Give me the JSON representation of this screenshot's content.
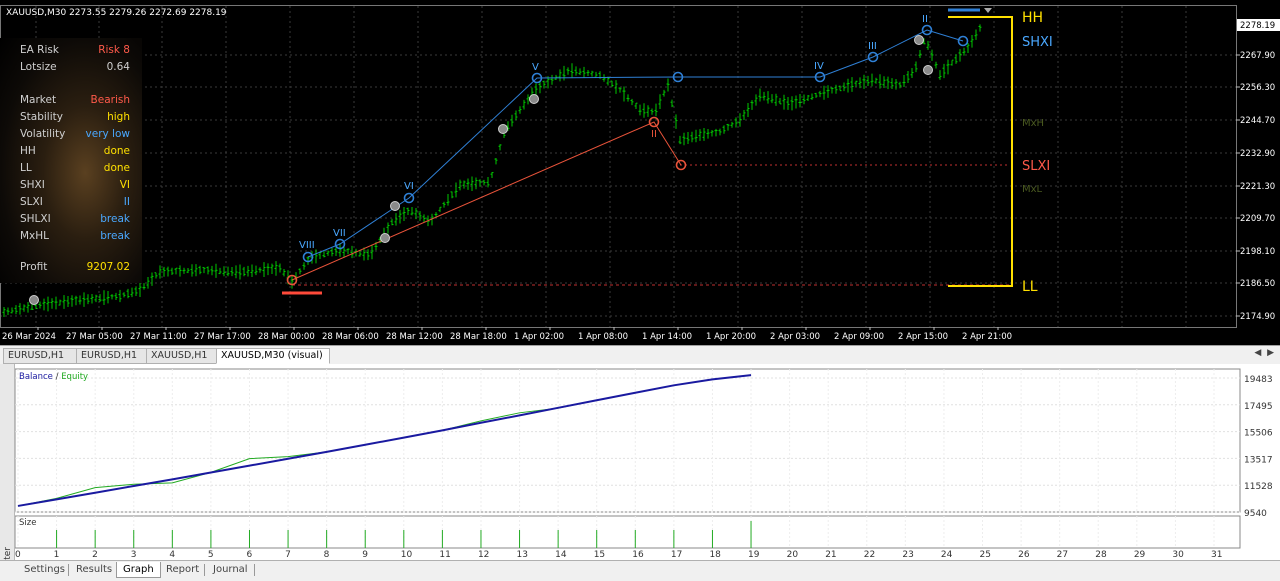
{
  "chart": {
    "symbol_info": "XAUUSD,M30  2273.55 2279.26 2272.69 2278.19",
    "current_price": "2278.19",
    "y_axis": [
      "2267.90",
      "2256.30",
      "2244.70",
      "2232.90",
      "2221.30",
      "2209.70",
      "2198.10",
      "2186.50",
      "2174.90"
    ],
    "x_axis": [
      "26 Mar 2024",
      "27 Mar 05:00",
      "27 Mar 11:00",
      "27 Mar 17:00",
      "28 Mar 00:00",
      "28 Mar 06:00",
      "28 Mar 12:00",
      "28 Mar 18:00",
      "1 Apr 02:00",
      "1 Apr 08:00",
      "1 Apr 14:00",
      "1 Apr 20:00",
      "2 Apr 03:00",
      "2 Apr 09:00",
      "2 Apr 15:00",
      "2 Apr 21:00"
    ],
    "range_labels": {
      "hh": "HH",
      "shxi": "SHXI",
      "mxh": "MxH",
      "slxi": "SLXI",
      "mxl": "MxL",
      "ll": "LL"
    },
    "swing_labels_high": [
      "VIII",
      "VII",
      "VI",
      "V",
      "IV",
      "III",
      "II"
    ],
    "swing_labels_low": [
      "II"
    ],
    "colors": {
      "up": "#00c800",
      "down": "#00c800",
      "high_line": "#2f80d6",
      "low_line": "#e8533a",
      "level": "#ffe000",
      "bg": "#000000"
    }
  },
  "ea_panel": {
    "rows": [
      {
        "key": "EA Risk",
        "value": "Risk 8",
        "color": "#ff5a4a"
      },
      {
        "key": "Lotsize",
        "value": "0.64",
        "color": "#d0d0d0"
      },
      {
        "key": "Market",
        "value": "Bearish",
        "color": "#ff5a4a"
      },
      {
        "key": "Stability",
        "value": "high",
        "color": "#ffe000"
      },
      {
        "key": "Volatility",
        "value": "very low",
        "color": "#4aa8ff"
      },
      {
        "key": "HH",
        "value": "done",
        "color": "#ffe000"
      },
      {
        "key": "LL",
        "value": "done",
        "color": "#ffe000"
      },
      {
        "key": "SHXI",
        "value": "VI",
        "color": "#ffe000"
      },
      {
        "key": "SLXI",
        "value": "II",
        "color": "#4aa8ff"
      },
      {
        "key": "SHLXI",
        "value": "break",
        "color": "#4aa8ff"
      },
      {
        "key": "MxHL",
        "value": "break",
        "color": "#4aa8ff"
      },
      {
        "key": "Profit",
        "value": "9207.02",
        "color": "#ffe000"
      }
    ]
  },
  "chart_tabs": [
    "EURUSD,H1",
    "EURUSD,H1",
    "XAUUSD,H1",
    "XAUUSD,M30 (visual)"
  ],
  "tester": {
    "side_label": "Tester",
    "legend_balance": "Balance",
    "legend_sep": " / ",
    "legend_equity": "Equity",
    "size_label": "Size",
    "y_ticks": [
      "19483",
      "17495",
      "15506",
      "13517",
      "11528",
      "9540"
    ],
    "x_ticks": [
      "0",
      "1",
      "2",
      "3",
      "4",
      "5",
      "6",
      "7",
      "8",
      "9",
      "10",
      "11",
      "12",
      "13",
      "14",
      "15",
      "16",
      "17",
      "18",
      "19",
      "20",
      "21",
      "22",
      "23",
      "24",
      "25",
      "26",
      "27",
      "28",
      "29",
      "30",
      "31"
    ],
    "chart_data": {
      "type": "line",
      "x": [
        0,
        1,
        2,
        3,
        4,
        5,
        6,
        7,
        8,
        9,
        10,
        11,
        12,
        13,
        14,
        15,
        16,
        17,
        18,
        19
      ],
      "series": [
        {
          "name": "Balance",
          "values": [
            9990,
            10480,
            10970,
            11470,
            11960,
            12470,
            12980,
            13490,
            14000,
            14530,
            15060,
            15600,
            16160,
            16710,
            17270,
            17830,
            18390,
            18940,
            19380,
            19700
          ]
        },
        {
          "name": "Equity",
          "values": [
            9990,
            10550,
            11350,
            11600,
            11700,
            12480,
            13500,
            13650,
            14000,
            14530,
            15060,
            15600,
            16300,
            16900,
            17250,
            17830,
            18390,
            18940,
            19380,
            19700
          ]
        }
      ],
      "ylim": [
        9540,
        19483
      ],
      "xlim": [
        0,
        31
      ],
      "size_values": [
        1,
        1,
        1,
        1,
        1,
        1,
        1,
        1,
        1,
        1,
        1,
        1,
        1,
        1,
        1,
        1,
        1,
        1,
        1.5
      ]
    }
  },
  "bottom_tabs": [
    "Settings",
    "Results",
    "Graph",
    "Report",
    "Journal"
  ]
}
